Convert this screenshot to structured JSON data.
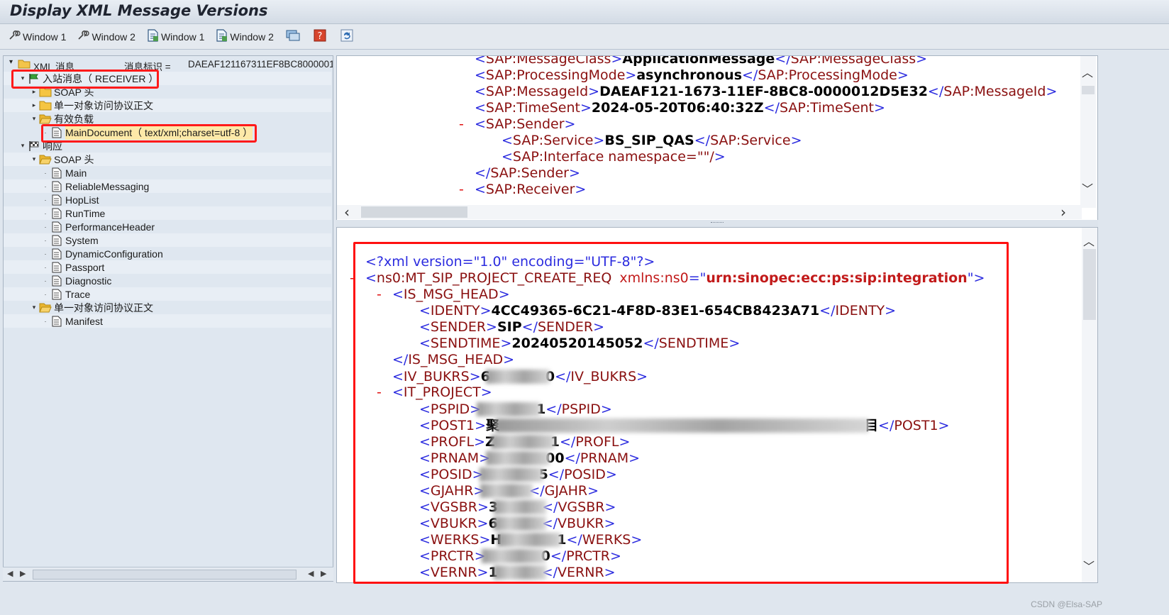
{
  "window": {
    "title": "Display XML Message Versions"
  },
  "toolbar": {
    "buttons": [
      {
        "label": "Window 1",
        "icon": "tool-icon"
      },
      {
        "label": "Window 2",
        "icon": "tool-icon"
      },
      {
        "label": "Window 1",
        "icon": "document-icon"
      },
      {
        "label": "Window 2",
        "icon": "document-icon"
      }
    ],
    "extra_icons": [
      "monitor-icon",
      "help-icon",
      "refresh-icon"
    ]
  },
  "tree": {
    "header": {
      "root_label": "XML 消息",
      "msgid_label": "消息标识 =",
      "msgid_value": "DAEAF121167311EF8BC8000001"
    },
    "items": [
      {
        "label": "入站消息（ RECEIVER ）",
        "icon": "flag-icon",
        "level": 1,
        "expander": "▾"
      },
      {
        "label": "SOAP 头",
        "icon": "folder-icon",
        "level": 2,
        "expander": "▸"
      },
      {
        "label": "单一对象访问协议正文",
        "icon": "folder-icon",
        "level": 2,
        "expander": "▸"
      },
      {
        "label": "有效负载",
        "icon": "folder-open-icon",
        "level": 2,
        "expander": "▾"
      },
      {
        "label": "MainDocument（ text/xml;charset=utf-8 ）",
        "icon": "document-icon",
        "level": 3,
        "expander": "·"
      },
      {
        "label": "响应",
        "icon": "flag-checkered-icon",
        "level": 1,
        "expander": "▾"
      },
      {
        "label": "SOAP 头",
        "icon": "folder-open-icon",
        "level": 2,
        "expander": "▾"
      },
      {
        "label": "Main",
        "icon": "document-icon",
        "level": 3,
        "expander": "·"
      },
      {
        "label": "ReliableMessaging",
        "icon": "document-icon",
        "level": 3,
        "expander": "·"
      },
      {
        "label": "HopList",
        "icon": "document-icon",
        "level": 3,
        "expander": "·"
      },
      {
        "label": "RunTime",
        "icon": "document-icon",
        "level": 3,
        "expander": "·"
      },
      {
        "label": "PerformanceHeader",
        "icon": "document-icon",
        "level": 3,
        "expander": "·"
      },
      {
        "label": "System",
        "icon": "document-icon",
        "level": 3,
        "expander": "·"
      },
      {
        "label": "DynamicConfiguration",
        "icon": "document-icon",
        "level": 3,
        "expander": "·"
      },
      {
        "label": "Passport",
        "icon": "document-icon",
        "level": 3,
        "expander": "·"
      },
      {
        "label": "Diagnostic",
        "icon": "document-icon",
        "level": 3,
        "expander": "·"
      },
      {
        "label": "Trace",
        "icon": "document-icon",
        "level": 3,
        "expander": "·"
      },
      {
        "label": "单一对象访问协议正文",
        "icon": "folder-open-icon",
        "level": 2,
        "expander": "▾"
      },
      {
        "label": "Manifest",
        "icon": "document-icon",
        "level": 3,
        "expander": "·"
      }
    ]
  },
  "top_xml": [
    {
      "indent": 2,
      "tag": "SAP:MessageClass",
      "value": "ApplicationMessage",
      "close": "SAP:MessageClass"
    },
    {
      "indent": 2,
      "tag": "SAP:ProcessingMode",
      "value": "asynchronous",
      "close": "SAP:ProcessingMode"
    },
    {
      "indent": 2,
      "tag": "SAP:MessageId",
      "value": "DAEAF121-1673-11EF-8BC8-0000012D5E32",
      "close": "SAP:MessageId"
    },
    {
      "indent": 2,
      "tag": "SAP:TimeSent",
      "value": "2024-05-20T06:40:32Z",
      "close": "SAP:TimeSent"
    },
    {
      "indent": 2,
      "minus": true,
      "tag": "SAP:Sender"
    },
    {
      "indent": 3,
      "tag": "SAP:Service",
      "value": "BS_SIP_QAS",
      "close": "SAP:Service"
    },
    {
      "indent": 3,
      "selfclose": "SAP:Interface namespace=\"\"/"
    },
    {
      "indent": 2,
      "closeonly": "SAP:Sender"
    },
    {
      "indent": 2,
      "minus": true,
      "tag": "SAP:Receiver"
    }
  ],
  "bottom_xml": {
    "decl": "<?xml version=\"1.0\" encoding=\"UTF-8\"?>",
    "root_tag": "ns0:MT_SIP_PROJECT_CREATE_REQ",
    "root_attr": "xmlns:ns0",
    "root_attr_value": "urn:sinopec:ecc:ps:sip:integration",
    "lines": [
      {
        "indent": 1,
        "minus": true,
        "tag": "IS_MSG_HEAD"
      },
      {
        "indent": 2,
        "tag": "IDENTY",
        "value": "4CC49365-6C21-4F8D-83E1-654CB8423A71",
        "close": "IDENTY"
      },
      {
        "indent": 2,
        "tag": "SENDER",
        "value": "SIP",
        "close": "SENDER"
      },
      {
        "indent": 2,
        "tag": "SENDTIME",
        "value": "20240520145052",
        "close": "SENDTIME"
      },
      {
        "indent": 1,
        "closeonly": "IS_MSG_HEAD"
      },
      {
        "indent": 1,
        "tag": "IV_BUKRS",
        "value": "6",
        "value_tail": "0",
        "redacted": true,
        "close": "IV_BUKRS"
      },
      {
        "indent": 1,
        "minus": true,
        "tag": "IT_PROJECT"
      },
      {
        "indent": 2,
        "tag": "PSPID",
        "value": "",
        "value_tail": "1",
        "redacted": true,
        "close": "PSPID"
      },
      {
        "indent": 2,
        "tag": "POST1",
        "value": "聚",
        "value_tail": "目",
        "redacted": true,
        "wide": true,
        "close": "POST1"
      },
      {
        "indent": 2,
        "tag": "PROFL",
        "value": "Z",
        "value_tail": "1",
        "redacted": true,
        "close": "PROFL"
      },
      {
        "indent": 2,
        "tag": "PRNAM",
        "value": "",
        "value_tail": "00",
        "redacted": true,
        "close": "PRNAM"
      },
      {
        "indent": 2,
        "tag": "POSID",
        "value": "",
        "value_tail": "5",
        "redacted": true,
        "close": "POSID"
      },
      {
        "indent": 2,
        "tag": "GJAHR",
        "value": "",
        "value_tail": "",
        "redacted": true,
        "close": "GJAHR"
      },
      {
        "indent": 2,
        "tag": "VGSBR",
        "value": "3",
        "value_tail": "",
        "redacted": true,
        "close": "VGSBR"
      },
      {
        "indent": 2,
        "tag": "VBUKR",
        "value": "6",
        "value_tail": "",
        "redacted": true,
        "close": "VBUKR"
      },
      {
        "indent": 2,
        "tag": "WERKS",
        "value": "H",
        "value_tail": "1",
        "redacted": true,
        "close": "WERKS"
      },
      {
        "indent": 2,
        "tag": "PRCTR",
        "value": "",
        "value_tail": "0",
        "redacted": true,
        "close": "PRCTR"
      },
      {
        "indent": 2,
        "tag": "VERNR",
        "value": "1",
        "value_tail": "",
        "redacted": true,
        "close": "VERNR"
      }
    ]
  },
  "watermark": "CSDN @Elsa-SAP"
}
